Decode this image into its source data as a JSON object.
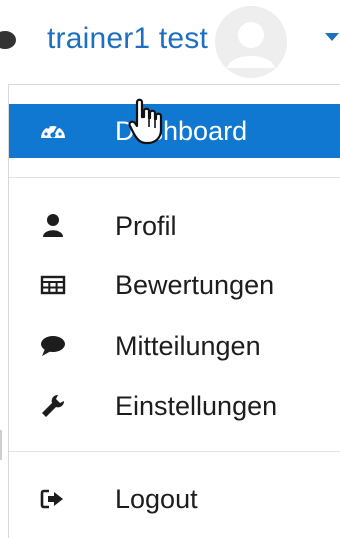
{
  "user": {
    "name": "trainer1 test",
    "icons": [
      "user-avatar",
      "caret-down-icon",
      "status-dot"
    ]
  },
  "menu": {
    "items": [
      {
        "label": "Dashboard",
        "icon": "dashboard-gauge-icon",
        "active": true
      },
      {
        "label": "Profil",
        "icon": "user-icon",
        "active": false
      },
      {
        "label": "Bewertungen",
        "icon": "table-icon",
        "active": false
      },
      {
        "label": "Mitteilungen",
        "icon": "chat-bubble-icon",
        "active": false
      },
      {
        "label": "Einstellungen",
        "icon": "wrench-icon",
        "active": false
      },
      {
        "label": "Logout",
        "icon": "sign-out-icon",
        "active": false
      }
    ]
  },
  "colors": {
    "accent": "#1178d2",
    "link": "#1e6fc0",
    "text": "#1d1d1d"
  }
}
